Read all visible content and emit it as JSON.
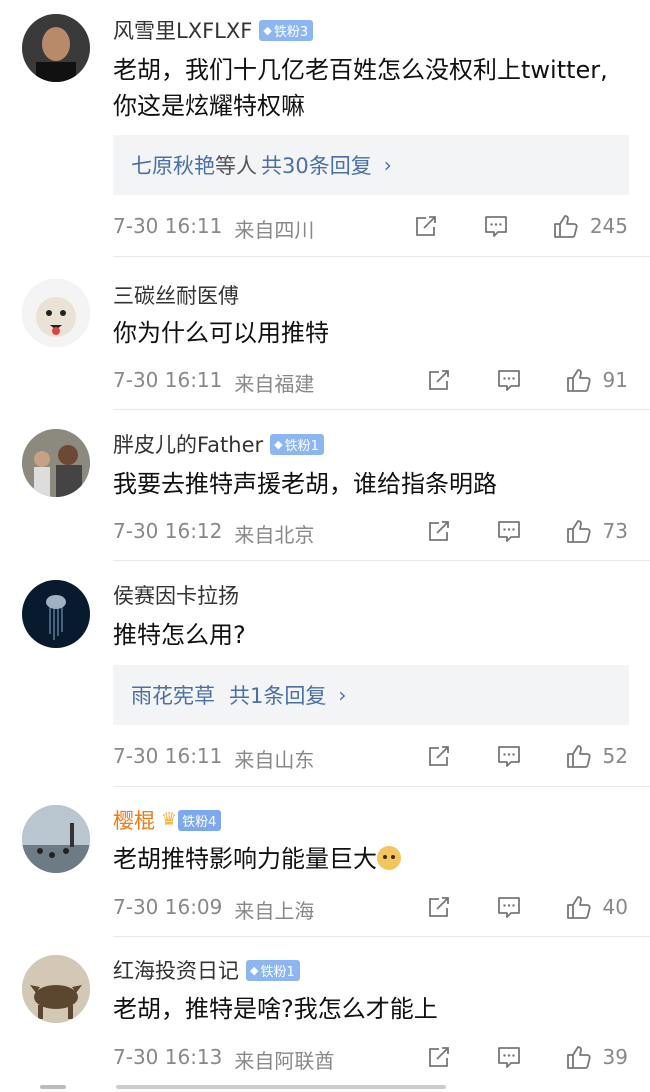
{
  "comments": [
    {
      "username": "风雪里LXFLXF",
      "badge": "铁粉3",
      "text": "老胡，我们十几亿老百姓怎么没权利上twitter,你这是炫耀特权嘛",
      "reply": {
        "names": "七原秋艳",
        "middle": "等人",
        "count": "共30条回复"
      },
      "time": "7-30 16:11",
      "location": "来自四川",
      "likes": "245"
    },
    {
      "username": "三碳丝耐医傅",
      "text": "你为什么可以用推特",
      "time": "7-30 16:11",
      "location": "来自福建",
      "likes": "91"
    },
    {
      "username": "胖皮儿的Father",
      "badge": "铁粉1",
      "text": "我要去推特声援老胡，谁给指条明路",
      "time": "7-30 16:12",
      "location": "来自北京",
      "likes": "73"
    },
    {
      "username": "侯赛因卡拉扬",
      "text": "推特怎么用?",
      "reply": {
        "names": "雨花宪草",
        "middle": "",
        "count": "共1条回复"
      },
      "time": "7-30 16:11",
      "location": "来自山东",
      "likes": "52"
    },
    {
      "username": "樱棍",
      "badge": "铁粉4",
      "text": "老胡推特影响力能量巨大",
      "time": "7-30 16:09",
      "location": "来自上海",
      "likes": "40"
    },
    {
      "username": "红海投资日记",
      "badge": "铁粉1",
      "text": "老胡，推特是啥?我怎么才能上",
      "time": "7-30 16:13",
      "location": "来自阿联酋",
      "likes": "39"
    }
  ],
  "colors": {
    "vip_name": "#f07a13",
    "badge_bg": "#8cb6f2",
    "link": "#4a6fa5"
  },
  "icons": [
    "share-icon",
    "comment-icon",
    "like-icon",
    "chevron-right-icon",
    "crown-icon",
    "diamond-icon",
    "doge-emoji-icon"
  ]
}
